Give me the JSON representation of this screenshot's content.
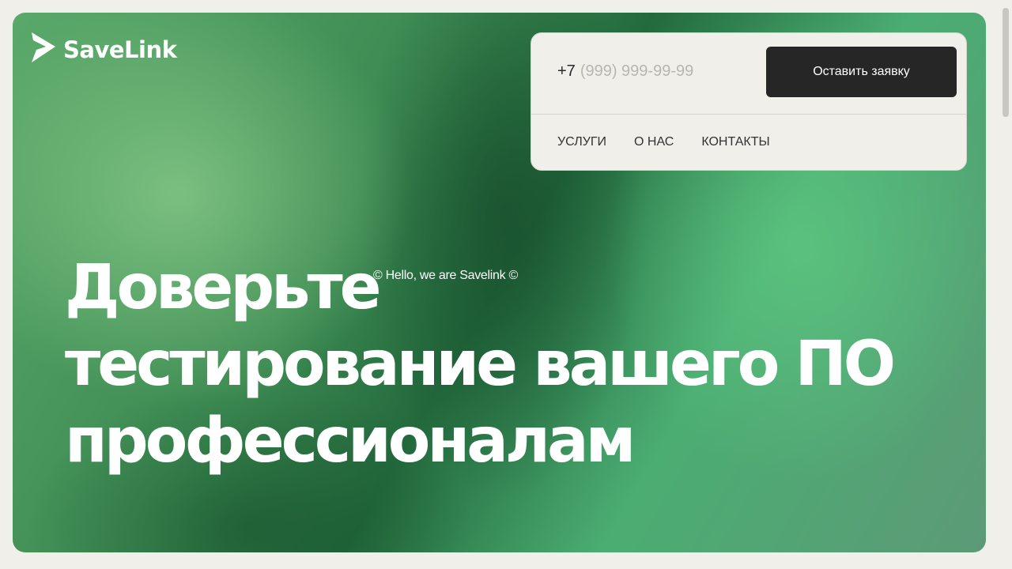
{
  "brand": {
    "name": "SaveLink",
    "logo_icon": "savelink-arrow-icon"
  },
  "panel": {
    "phone": {
      "prefix": "+7",
      "placeholder": "(999) 999-99-99"
    },
    "cta_label": "Оставить заявку",
    "nav": [
      "УСЛУГИ",
      "О НАС",
      "КОНТАКТЫ"
    ]
  },
  "hero": {
    "headline_lines": [
      "Доверьте",
      "тестирование вашего ПО",
      "профессионалам"
    ],
    "tagline": "© Hello, we are Savelink ©"
  },
  "colors": {
    "page_bg": "#f1efe9",
    "button_bg": "#262626",
    "hero_green": "#3c8a52"
  }
}
